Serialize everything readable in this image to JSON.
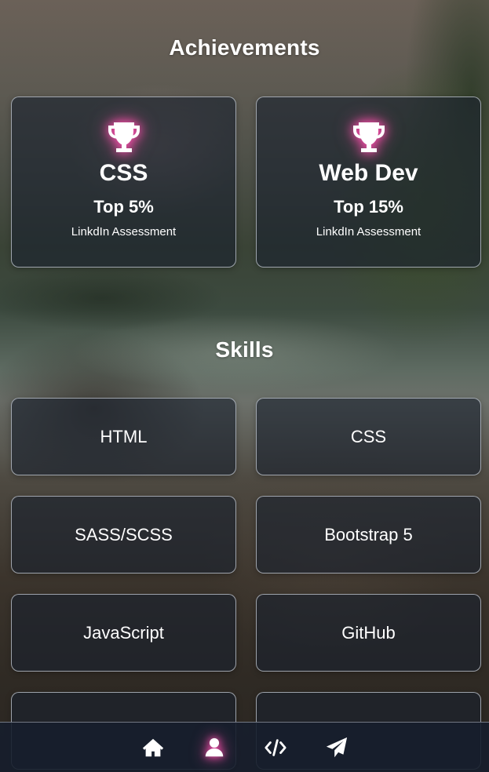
{
  "achievements": {
    "title": "Achievements",
    "items": [
      {
        "name": "CSS",
        "rank": "Top 5%",
        "desc": "LinkdIn Assessment"
      },
      {
        "name": "Web Dev",
        "rank": "Top 15%",
        "desc": "LinkdIn Assessment"
      }
    ]
  },
  "skills": {
    "title": "Skills",
    "items": [
      "HTML",
      "CSS",
      "SASS/SCSS",
      "Bootstrap 5",
      "JavaScript",
      "GitHub",
      "",
      ""
    ]
  },
  "nav": {
    "items": [
      {
        "icon": "home-icon",
        "active": false
      },
      {
        "icon": "user-icon",
        "active": true
      },
      {
        "icon": "code-icon",
        "active": false
      },
      {
        "icon": "paper-plane-icon",
        "active": false
      }
    ]
  },
  "colors": {
    "accent_glow": "#ff4fb0",
    "card_bg": "#19202d",
    "card_border": "#c8cdd7"
  }
}
